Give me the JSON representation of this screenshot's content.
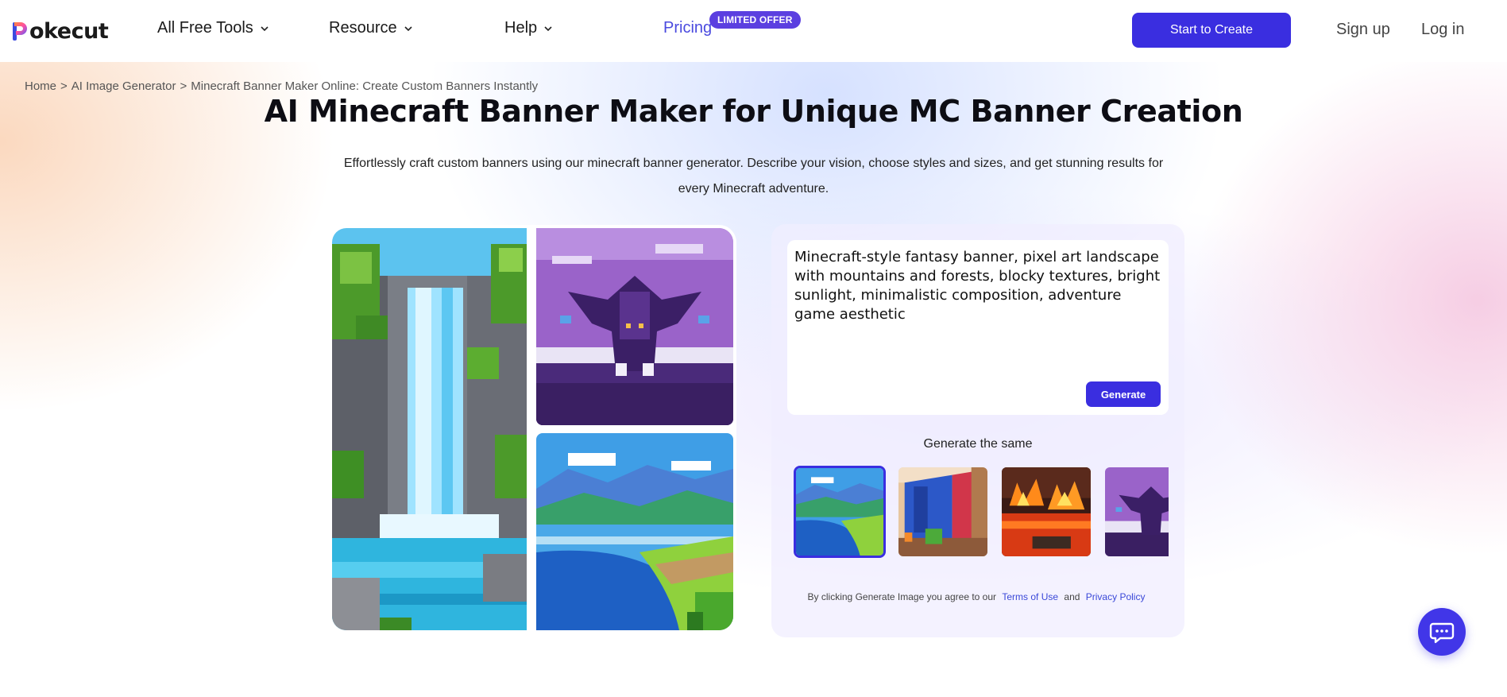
{
  "brand": {
    "logo_text": "okecut",
    "logo_letter": "P"
  },
  "nav": {
    "items": [
      {
        "label": "All Free Tools"
      },
      {
        "label": "Resource"
      },
      {
        "label": "Help"
      }
    ],
    "pricing": "Pricing",
    "offer_badge": "LIMITED OFFER",
    "start_button": "Start to Create",
    "sign_up": "Sign up",
    "log_in": "Log in"
  },
  "breadcrumb": {
    "home": "Home",
    "sep": ">",
    "ai_image_generator": "AI Image Generator",
    "current": "Minecraft Banner Maker Online: Create Custom Banners Instantly"
  },
  "hero": {
    "title": "AI Minecraft Banner Maker for Unique MC Banner Creation",
    "subtitle": "Effortlessly craft custom banners using our minecraft banner generator. Describe your vision, choose styles and sizes, and get stunning results for every Minecraft adventure."
  },
  "showcase": {
    "images": [
      "pixel-waterfall",
      "pixel-purple-dragon",
      "pixel-mountain-lake"
    ]
  },
  "generator": {
    "prompt": "Minecraft-style fantasy banner, pixel art landscape with mountains and forests, blocky textures, bright sunlight, minimalistic composition, adventure game aesthetic",
    "generate_button": "Generate",
    "same_label": "Generate the same",
    "thumbnails": [
      "pixel-mountain-lake",
      "pixel-blocky-wall",
      "pixel-lava-fire",
      "pixel-purple-dragon"
    ],
    "selected_thumbnail": 0
  },
  "terms": {
    "prefix": "By clicking Generate Image you agree to our",
    "terms_link": "Terms of Use",
    "and": "and",
    "privacy_link": "Privacy Policy"
  },
  "icons": {
    "chat": "chat-bubble-icon",
    "chevron": "chevron-down-icon"
  },
  "colors": {
    "accent": "#3a2ee0",
    "badge": "#5b3fe0",
    "link": "#3a48d8"
  }
}
